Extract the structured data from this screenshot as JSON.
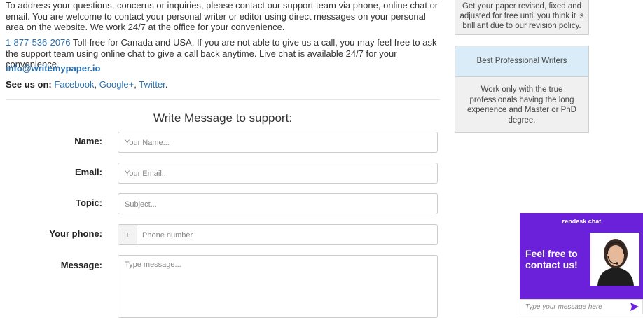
{
  "intro": {
    "paragraph1": "To address your questions, concerns or inquiries, please contact our support team via phone, online chat or email. You are welcome to contact your personal writer or editor using direct messages on your personal area on the website. We work 24/7 at the office for your convenience.",
    "phone": "1-877-536-2076",
    "paragraph2": " Toll-free for Canada and USA. If you are not able to give us a call, you may feel free to ask the support team using online chat to give a call back anytime. Live chat is available 24/7 for your convenience.",
    "email": "info@writemypaper.io",
    "see_us_label": "See us on:",
    "social": [
      "Facebook",
      "Google+",
      "Twitter"
    ]
  },
  "form": {
    "title": "Write Message to support:",
    "name_label": "Name:",
    "name_placeholder": "Your Name...",
    "email_label": "Email:",
    "email_placeholder": "Your Email...",
    "topic_label": "Topic:",
    "topic_placeholder": "Subject...",
    "phone_label": "Your phone:",
    "phone_prefix": "+",
    "phone_placeholder": "Phone number",
    "message_label": "Message:",
    "message_placeholder": "Type message..."
  },
  "sidebar": {
    "box1_text": "Get your paper revised, fixed and adjusted for free until you think it is brilliant due to our revision policy.",
    "box2_title": "Best Professional Writers",
    "box2_text": "Work only with the true professionals having the long experience and Master or PhD degree."
  },
  "chat": {
    "brand": "zendesk chat",
    "headline": "Feel free  to contact us!",
    "input_placeholder": "Type your message here",
    "accent": "#6a21d9"
  }
}
